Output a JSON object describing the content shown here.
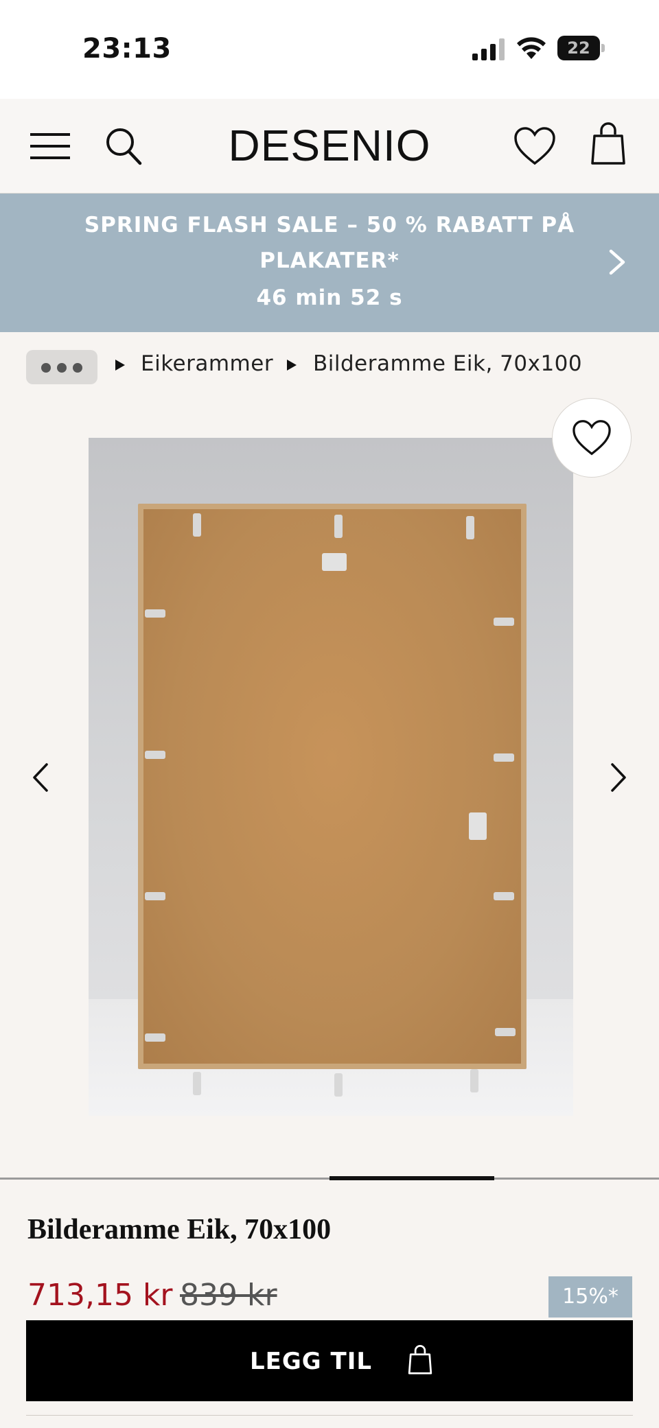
{
  "status_bar": {
    "time": "23:13",
    "battery": "22"
  },
  "header": {
    "logo": "DESENIO"
  },
  "promo": {
    "text": "SPRING FLASH SALE – 50 % RABATT PÅ PLAKATER*",
    "timer": "46 min 52 s"
  },
  "breadcrumb": {
    "items": [
      "Eikerammer",
      "Bilderamme Eik, 70x100"
    ]
  },
  "gallery": {
    "current_index": 3,
    "total": 4
  },
  "product": {
    "title": "Bilderamme Eik, 70x100",
    "price": "713,15 kr",
    "original_price": "839 kr",
    "discount": "15%*",
    "add_button": "LEGG TIL"
  },
  "colors": {
    "promo_bg": "#a2b5c2",
    "sale_price": "#a3121e",
    "button_bg": "#000000"
  }
}
